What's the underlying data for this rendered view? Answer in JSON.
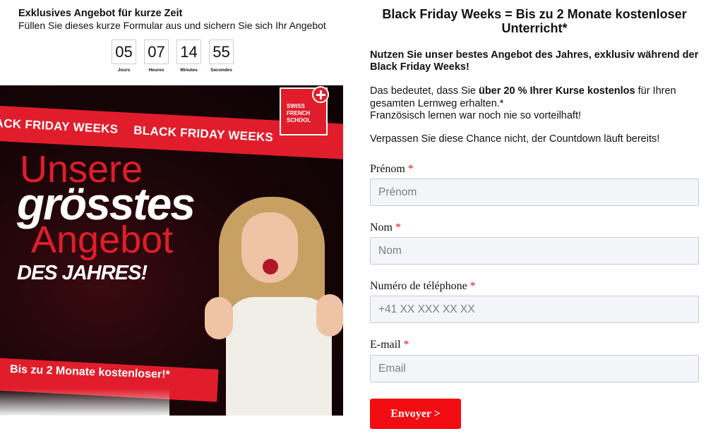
{
  "offer": {
    "title": "Exklusives Angebot für kurze Zeit",
    "subtitle": "Füllen Sie dieses kurze Formular aus und sichern Sie sich Ihr Angebot"
  },
  "countdown": [
    {
      "value": "05",
      "label": "Jours"
    },
    {
      "value": "07",
      "label": "Heures"
    },
    {
      "value": "14",
      "label": "Minutes"
    },
    {
      "value": "55",
      "label": "Secondes"
    }
  ],
  "banner": {
    "strip_text": "ACK FRIDAY WEEKS",
    "strip_text_2": "BLACK FRIDAY WEEKS",
    "logo_text": "SWISS FRENCH SCHOOL",
    "line1": "Unsere",
    "line2": "grösstes",
    "line3": "Angebot",
    "line4": "DES JAHRES!",
    "bottom_text": "Bis zu 2 Monate kostenloser!*"
  },
  "content": {
    "title": "Black Friday Weeks = Bis zu 2 Monate kostenloser Unterricht*",
    "lead": "Nutzen Sie unser bestes Angebot des Jahres, exklusiv während der Black Friday Weeks!",
    "para1_before": "Das bedeutet, dass Sie ",
    "para1_bold": "über 20 % Ihrer Kurse kostenlos",
    "para1_after": " für Ihren gesamten Lernweg erhalten.*",
    "para1_line2": "Französisch lernen war noch nie so vorteilhaft!",
    "para2": "Verpassen Sie diese Chance nicht, der Countdown läuft bereits!"
  },
  "form": {
    "required_mark": "*",
    "first_name": {
      "label": "Prénom",
      "placeholder": "Prénom",
      "value": ""
    },
    "last_name": {
      "label": "Nom",
      "placeholder": "Nom",
      "value": ""
    },
    "phone": {
      "label": "Numéro de téléphone",
      "placeholder": "+41 XX XXX XX XX",
      "value": ""
    },
    "email": {
      "label": "E-mail",
      "placeholder": "Email",
      "value": ""
    },
    "submit_label": "Envoyer >"
  },
  "colors": {
    "accent": "#f20d12",
    "banner_red": "#e11d2b",
    "input_bg": "#f3f5f8"
  }
}
